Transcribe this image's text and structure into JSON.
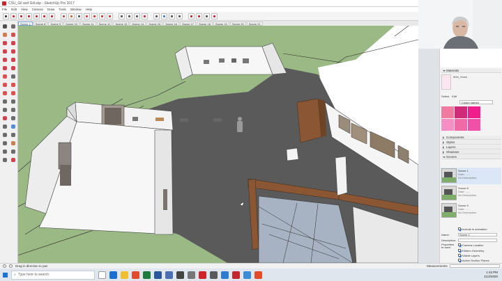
{
  "window": {
    "title": "CSU_Gil and Gill.skp - SketchUp Pro 2017"
  },
  "menu": [
    "File",
    "Edit",
    "View",
    "Camera",
    "Draw",
    "Tools",
    "Window",
    "Help"
  ],
  "scenes": {
    "tabs": [
      "Scene 1",
      "Scene 8",
      "Scene 9",
      "Scene 10",
      "Scene 11",
      "Scene 12",
      "Scene 13",
      "Scene 14",
      "Scene 15",
      "Scene 16",
      "Scene 17",
      "Scene 18",
      "Scene 19",
      "Scene 20",
      "Scene 21"
    ],
    "active_index": 0
  },
  "status": {
    "hint": "Drag in direction to pan",
    "measurements_label": "Measurements"
  },
  "taskbar": {
    "search_placeholder": "Type here to search",
    "time": "1:42 PM",
    "date": "11/2/2020"
  },
  "tray": {
    "materials_title": "Materials",
    "material_name": "M16_Snow",
    "select_tab": "Select",
    "edit_tab": "Edit",
    "collection": "Colors named",
    "swatch_colors": [
      "#f07aa0",
      "#d02a78",
      "#f01e8c",
      "#f690c4",
      "#f06aa8",
      "#f050a8"
    ],
    "panels": [
      "Components",
      "Styles",
      "Layers",
      "Shadows",
      "Scenes"
    ],
    "scene_list": [
      {
        "name": "Scene 1",
        "line2": "Date: ......",
        "line3": "No Description"
      },
      {
        "name": "Scene 8",
        "line2": "Date: ......",
        "line3": "No Description"
      },
      {
        "name": "Scene 9",
        "line2": "Date: ......",
        "line3": "No Description"
      }
    ],
    "include_in_animation": "Include in animation",
    "name_label": "Name:",
    "name_value": "Scene 1",
    "description_label": "Description:",
    "properties_label": "Properties to save:",
    "properties": [
      "Camera Location",
      "Hidden Geometry",
      "Visible Layers",
      "Active Section Planes"
    ]
  },
  "colors": {
    "ground": "#9ab985",
    "floor": "#5a5a5a",
    "wall": "#f7f7f7",
    "wood": "#8a5633"
  }
}
